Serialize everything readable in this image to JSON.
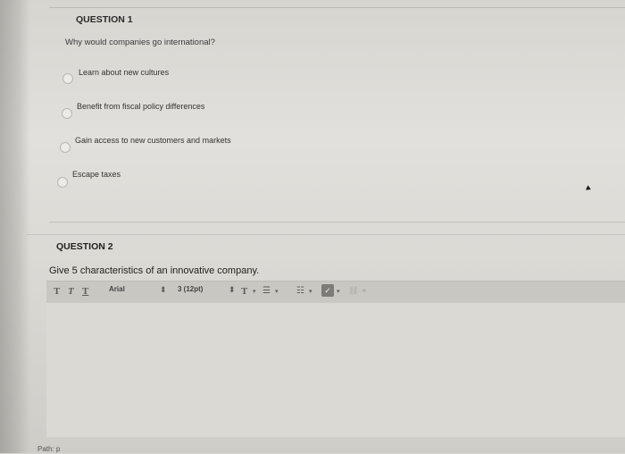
{
  "question1": {
    "title": "QUESTION 1",
    "prompt": "Why would companies go international?",
    "options": [
      {
        "label": "Learn about new cultures"
      },
      {
        "label": "Benefit from fiscal policy differences"
      },
      {
        "label": "Gain access to new customers and markets"
      },
      {
        "label": "Escape taxes"
      }
    ]
  },
  "question2": {
    "title": "QUESTION 2",
    "prompt": "Give 5 characteristics of an innovative company.",
    "toolbar": {
      "bold_icon": "T",
      "italic_icon": "T",
      "underline_icon": "T",
      "font_family": "Arial",
      "font_size": "3 (12pt)",
      "text_color_icon": "T"
    },
    "status_path": "Path: p"
  }
}
